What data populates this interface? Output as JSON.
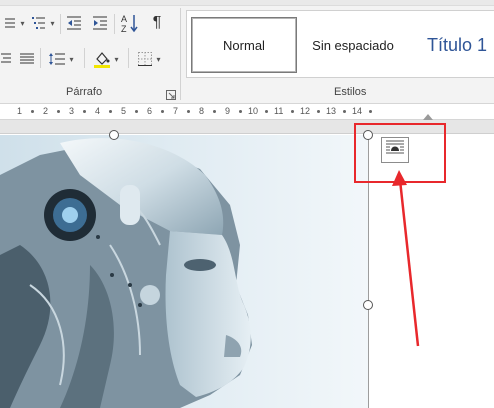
{
  "ribbon": {
    "paragraph_group_label": "Párrafo",
    "styles_group_label": "Estilos",
    "paragraph_tools": [
      {
        "name": "numbered-list-icon"
      },
      {
        "name": "multilevel-list-icon"
      },
      {
        "name": "decrease-indent-icon"
      },
      {
        "name": "increase-indent-icon"
      },
      {
        "name": "sort-az-icon"
      },
      {
        "name": "pilcrow-icon"
      },
      {
        "name": "align-center-icon"
      },
      {
        "name": "justify-icon"
      },
      {
        "name": "line-spacing-icon"
      },
      {
        "name": "shading-icon"
      },
      {
        "name": "borders-icon"
      }
    ],
    "styles": [
      {
        "label": "Normal",
        "active": true
      },
      {
        "label": "Sin espaciado",
        "active": false
      },
      {
        "label": "Título 1",
        "active": false
      }
    ],
    "heading_color": "#2f5597"
  },
  "ruler": {
    "numbers": [
      "1",
      "2",
      "3",
      "4",
      "5",
      "6",
      "7",
      "8",
      "9",
      "10",
      "11",
      "12",
      "13",
      "14"
    ]
  },
  "document": {
    "image": "robot-head-photo",
    "layout_options_icon": "layout-options-icon",
    "annotation_color": "#e8282c"
  }
}
